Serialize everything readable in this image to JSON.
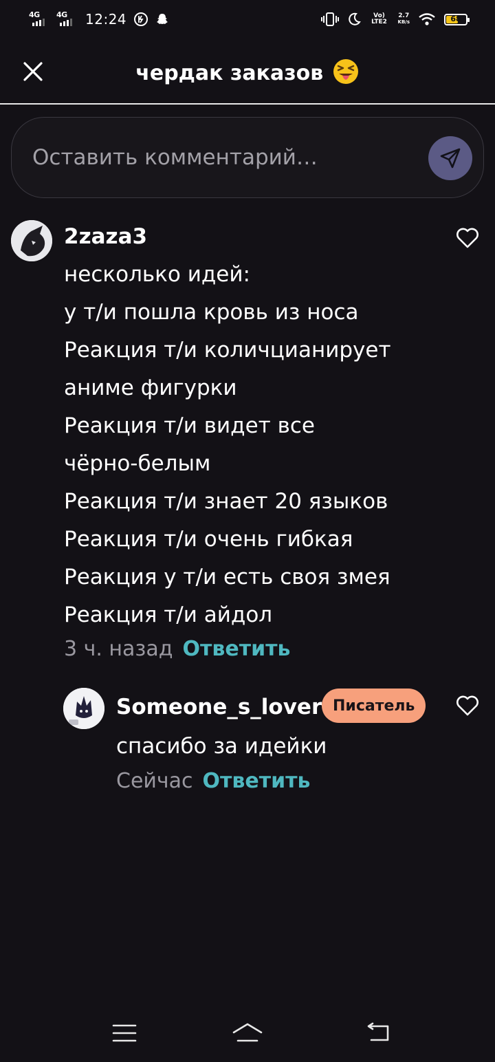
{
  "status_bar": {
    "time": "12:24",
    "network1": "4G",
    "network2": "4G",
    "volte_label": "Vo) LTE2",
    "speed_value": "2.7",
    "speed_unit": "KB/s",
    "battery": "68"
  },
  "header": {
    "title": "чердак заказов",
    "title_emoji": "squinting-face-with-tongue",
    "close_icon": "close-icon"
  },
  "comment_input": {
    "placeholder": "Оставить комментарий…",
    "value": "",
    "send_icon": "send-icon"
  },
  "comments": [
    {
      "author": "2zaza3",
      "lines": [
        "несколько идей:",
        "у т/и пошла кровь из носа",
        "Реакция т/и количцианирует",
        "аниме фигурки",
        "Реакция т/и видет все",
        "чёрно-белым",
        "Реакция т/и знает 20 языков",
        "Реакция т/и очень гибкая",
        "Реакция у т/и есть своя змея",
        "Реакция т/и айдол"
      ],
      "time": "3 ч. назад",
      "reply_label": "Ответить"
    }
  ],
  "reply": {
    "author": "Someone_s_lover",
    "badge": "Писатель",
    "text": "спасибо за идейки",
    "time": "Сейчас",
    "reply_label": "Ответить"
  },
  "colors": {
    "background": "#131116",
    "accent": "#4fb8c0",
    "badge": "#f7a07c",
    "send_button": "#5b5a85"
  },
  "nav_bar": {
    "icons": [
      "menu-icon",
      "home-icon",
      "back-icon"
    ]
  }
}
